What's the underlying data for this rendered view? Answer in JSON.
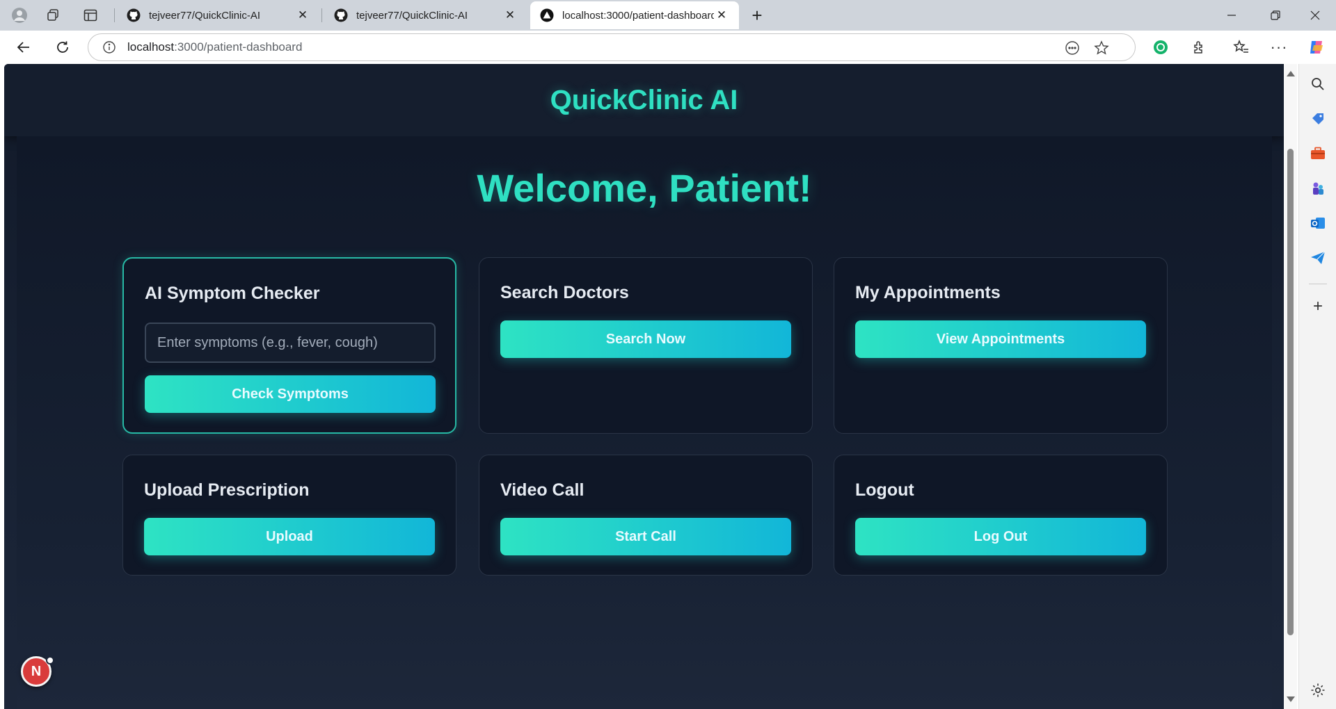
{
  "browser": {
    "tabs": [
      {
        "title": "tejveer77/QuickClinic-AI",
        "icon": "github-icon",
        "active": false
      },
      {
        "title": "tejveer77/QuickClinic-AI",
        "icon": "github-icon",
        "active": false
      },
      {
        "title": "localhost:3000/patient-dashboard",
        "icon": "nextjs-icon",
        "active": true
      }
    ],
    "url": {
      "host": "localhost",
      "rest": ":3000/patient-dashboard"
    }
  },
  "app": {
    "brand": "QuickClinic AI",
    "welcome": "Welcome, Patient!",
    "cards": {
      "symptom": {
        "title": "AI Symptom Checker",
        "placeholder": "Enter symptoms (e.g., fever, cough)",
        "button": "Check Symptoms"
      },
      "doctors": {
        "title": "Search Doctors",
        "button": "Search Now"
      },
      "appointments": {
        "title": "My Appointments",
        "button": "View Appointments"
      },
      "prescription": {
        "title": "Upload Prescription",
        "button": "Upload"
      },
      "video": {
        "title": "Video Call",
        "button": "Start Call"
      },
      "logout": {
        "title": "Logout",
        "button": "Log Out"
      }
    },
    "dev_badge": "N"
  },
  "colors": {
    "accent": "#2fe0c2",
    "button_start": "#2ee3c3",
    "button_end": "#12b6d8",
    "background": "#121a2a"
  }
}
